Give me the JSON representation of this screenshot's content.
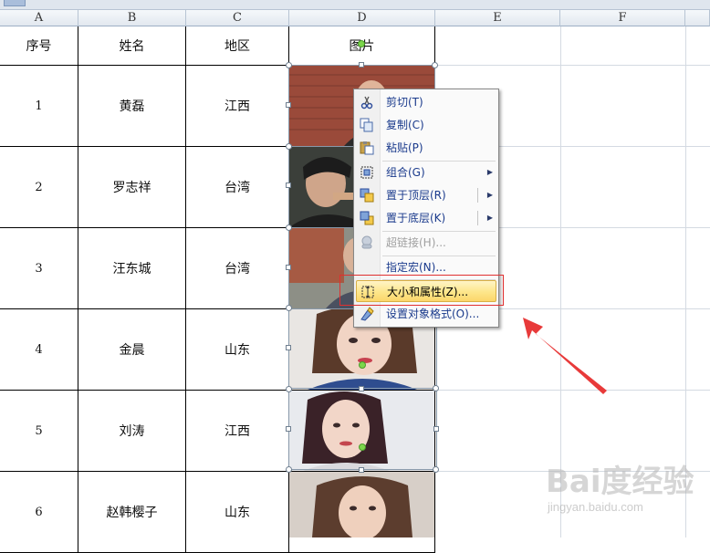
{
  "columns": [
    "A",
    "B",
    "C",
    "D",
    "E",
    "F"
  ],
  "header_row": {
    "col_a": "序号",
    "col_b": "姓名",
    "col_c": "地区",
    "col_d": "图片"
  },
  "rows": [
    {
      "no": "1",
      "name": "黄磊",
      "region": "江西"
    },
    {
      "no": "2",
      "name": "罗志祥",
      "region": "台湾"
    },
    {
      "no": "3",
      "name": "汪东城",
      "region": "台湾"
    },
    {
      "no": "4",
      "name": "金晨",
      "region": "山东"
    },
    {
      "no": "5",
      "name": "刘涛",
      "region": "江西"
    },
    {
      "no": "6",
      "name": "赵韩樱子",
      "region": "山东"
    }
  ],
  "context_menu": {
    "items": [
      {
        "label": "剪切(T)",
        "icon": "scissors-icon",
        "enabled": true
      },
      {
        "label": "复制(C)",
        "icon": "copy-icon",
        "enabled": true
      },
      {
        "label": "粘贴(P)",
        "icon": "paste-icon",
        "enabled": true
      },
      {
        "label": "组合(G)",
        "icon": "group-icon",
        "enabled": true,
        "submenu": true
      },
      {
        "label": "置于顶层(R)",
        "icon": "bring-to-front-icon",
        "enabled": true,
        "submenu": true
      },
      {
        "label": "置于底层(K)",
        "icon": "send-to-back-icon",
        "enabled": true,
        "submenu": true
      },
      {
        "label": "超链接(H)...",
        "icon": "hyperlink-icon",
        "enabled": false
      },
      {
        "label": "指定宏(N)...",
        "icon": "",
        "enabled": true
      },
      {
        "label": "大小和属性(Z)...",
        "icon": "size-properties-icon",
        "enabled": true,
        "highlighted": true
      },
      {
        "label": "设置对象格式(O)...",
        "icon": "format-object-icon",
        "enabled": true
      }
    ]
  },
  "watermark": {
    "text": "Bai度经验",
    "sub": "jingyan.baidu.com"
  },
  "colors": {
    "highlight": "#fde68a",
    "annotation_red": "#e03030"
  }
}
